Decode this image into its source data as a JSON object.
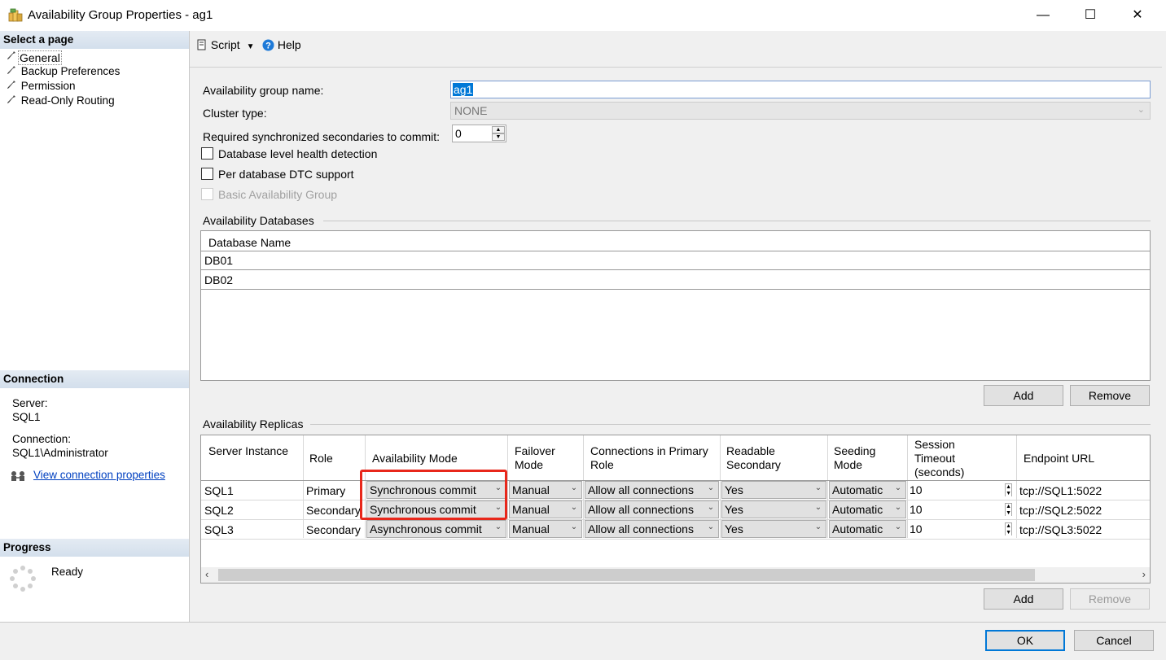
{
  "window": {
    "title": "Availability Group Properties - ag1",
    "minimize": "—",
    "maximize": "☐",
    "close": "✕"
  },
  "sidebar": {
    "select_page_title": "Select a page",
    "pages": [
      {
        "label": "General",
        "icon": "wrench-icon",
        "selected": true
      },
      {
        "label": "Backup Preferences",
        "icon": "wrench-icon"
      },
      {
        "label": "Permission",
        "icon": "wrench-icon"
      },
      {
        "label": "Read-Only Routing",
        "icon": "wrench-icon"
      }
    ],
    "connection_title": "Connection",
    "server_label": "Server:",
    "server_value": "SQL1",
    "connection_label": "Connection:",
    "connection_value": "SQL1\\Administrator",
    "view_link": "View connection properties",
    "progress_title": "Progress",
    "progress_status": "Ready"
  },
  "toolbar": {
    "script_label": "Script",
    "help_label": "Help"
  },
  "general": {
    "ag_name_label": "Availability group name:",
    "ag_name_value": "ag1",
    "cluster_type_label": "Cluster type:",
    "cluster_type_value": "NONE",
    "req_sync_label": "Required synchronized secondaries to commit:",
    "req_sync_value": "0",
    "db_health_label": "Database level health detection",
    "dtc_label": "Per database DTC support",
    "basic_ag_label": "Basic Availability Group"
  },
  "databases": {
    "section_title": "Availability Databases",
    "column_header": "Database Name",
    "rows": [
      "DB01",
      "DB02"
    ],
    "add_label": "Add",
    "remove_label": "Remove"
  },
  "replicas": {
    "section_title": "Availability Replicas",
    "headers": {
      "server_instance": "Server Instance",
      "role": "Role",
      "availability_mode": "Availability Mode",
      "failover_mode": "Failover Mode",
      "connections_primary": "Connections in Primary Role",
      "readable_secondary": "Readable Secondary",
      "seeding_mode": "Seeding Mode",
      "session_timeout": "Session Timeout (seconds)",
      "endpoint_url": "Endpoint URL"
    },
    "rows": [
      {
        "server": "SQL1",
        "role": "Primary",
        "mode": "Synchronous commit",
        "failover": "Manual",
        "connections": "Allow all connections",
        "readable": "Yes",
        "seeding": "Automatic",
        "timeout": "10",
        "endpoint": "tcp://SQL1:5022"
      },
      {
        "server": "SQL2",
        "role": "Secondary",
        "mode": "Synchronous commit",
        "failover": "Manual",
        "connections": "Allow all connections",
        "readable": "Yes",
        "seeding": "Automatic",
        "timeout": "10",
        "endpoint": "tcp://SQL2:5022"
      },
      {
        "server": "SQL3",
        "role": "Secondary",
        "mode": "Asynchronous commit",
        "failover": "Manual",
        "connections": "Allow all connections",
        "readable": "Yes",
        "seeding": "Automatic",
        "timeout": "10",
        "endpoint": "tcp://SQL3:5022"
      }
    ],
    "add_label": "Add",
    "remove_label": "Remove"
  },
  "footer": {
    "ok_label": "OK",
    "cancel_label": "Cancel"
  },
  "colors": {
    "highlight_box": "#e8271b",
    "link": "#0040c0",
    "selection": "#0078d7"
  }
}
